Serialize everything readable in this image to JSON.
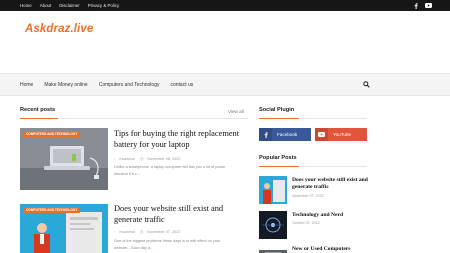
{
  "topbar": {
    "links": [
      "Home",
      "About",
      "Disclaimer",
      "Privacy & Policy"
    ],
    "social_icons": [
      "facebook-icon",
      "youtube-icon"
    ]
  },
  "logo": {
    "text": "Askdraz.live"
  },
  "nav": {
    "items": [
      "Home",
      "Make Money online",
      "Computers and Technology",
      "contact us"
    ],
    "search_icon": "search-icon"
  },
  "recent": {
    "title": "Recent posts",
    "view_all": "View all",
    "posts": [
      {
        "category": "COMPUTERS AND TECHNOLOGY",
        "title_line1": "Tips for buying the right replacement",
        "title_line2": "battery for your laptop",
        "author": "muzamul",
        "date": "November 08, 2022",
        "excerpt_line1": "Unlike a smartphone, a laptop computer will last you a lot of power",
        "excerpt_line2": "demand if it c..."
      },
      {
        "category": "COMPUTERS AND TECHNOLOGY",
        "title_line1": "Does your website still exist and",
        "title_line2": "generate traffic",
        "author": "muzamul",
        "date": "November 07, 2022",
        "excerpt_line1": "One of the biggest problems these days is to edit effect on your",
        "excerpt_line2": "website... Each day a..."
      }
    ]
  },
  "social_plugin": {
    "title": "Social Plugin",
    "facebook_label": "Facebook",
    "youtube_label": "YouTube",
    "colors": {
      "facebook": "#3b5998",
      "youtube": "#e1553d"
    }
  },
  "popular": {
    "title": "Popular Posts",
    "posts": [
      {
        "title_line1": "Does your website still exist and",
        "title_line2": "generate traffic",
        "date": "November 07, 2022"
      },
      {
        "title_line1": "Technology and Nerd",
        "title_line2": "",
        "date": "October 07, 2022"
      },
      {
        "title_line1": "New or Used Computers",
        "title_line2": "",
        "date": ""
      }
    ]
  },
  "colors": {
    "accent": "#e8702a",
    "topbar": "#161616"
  }
}
